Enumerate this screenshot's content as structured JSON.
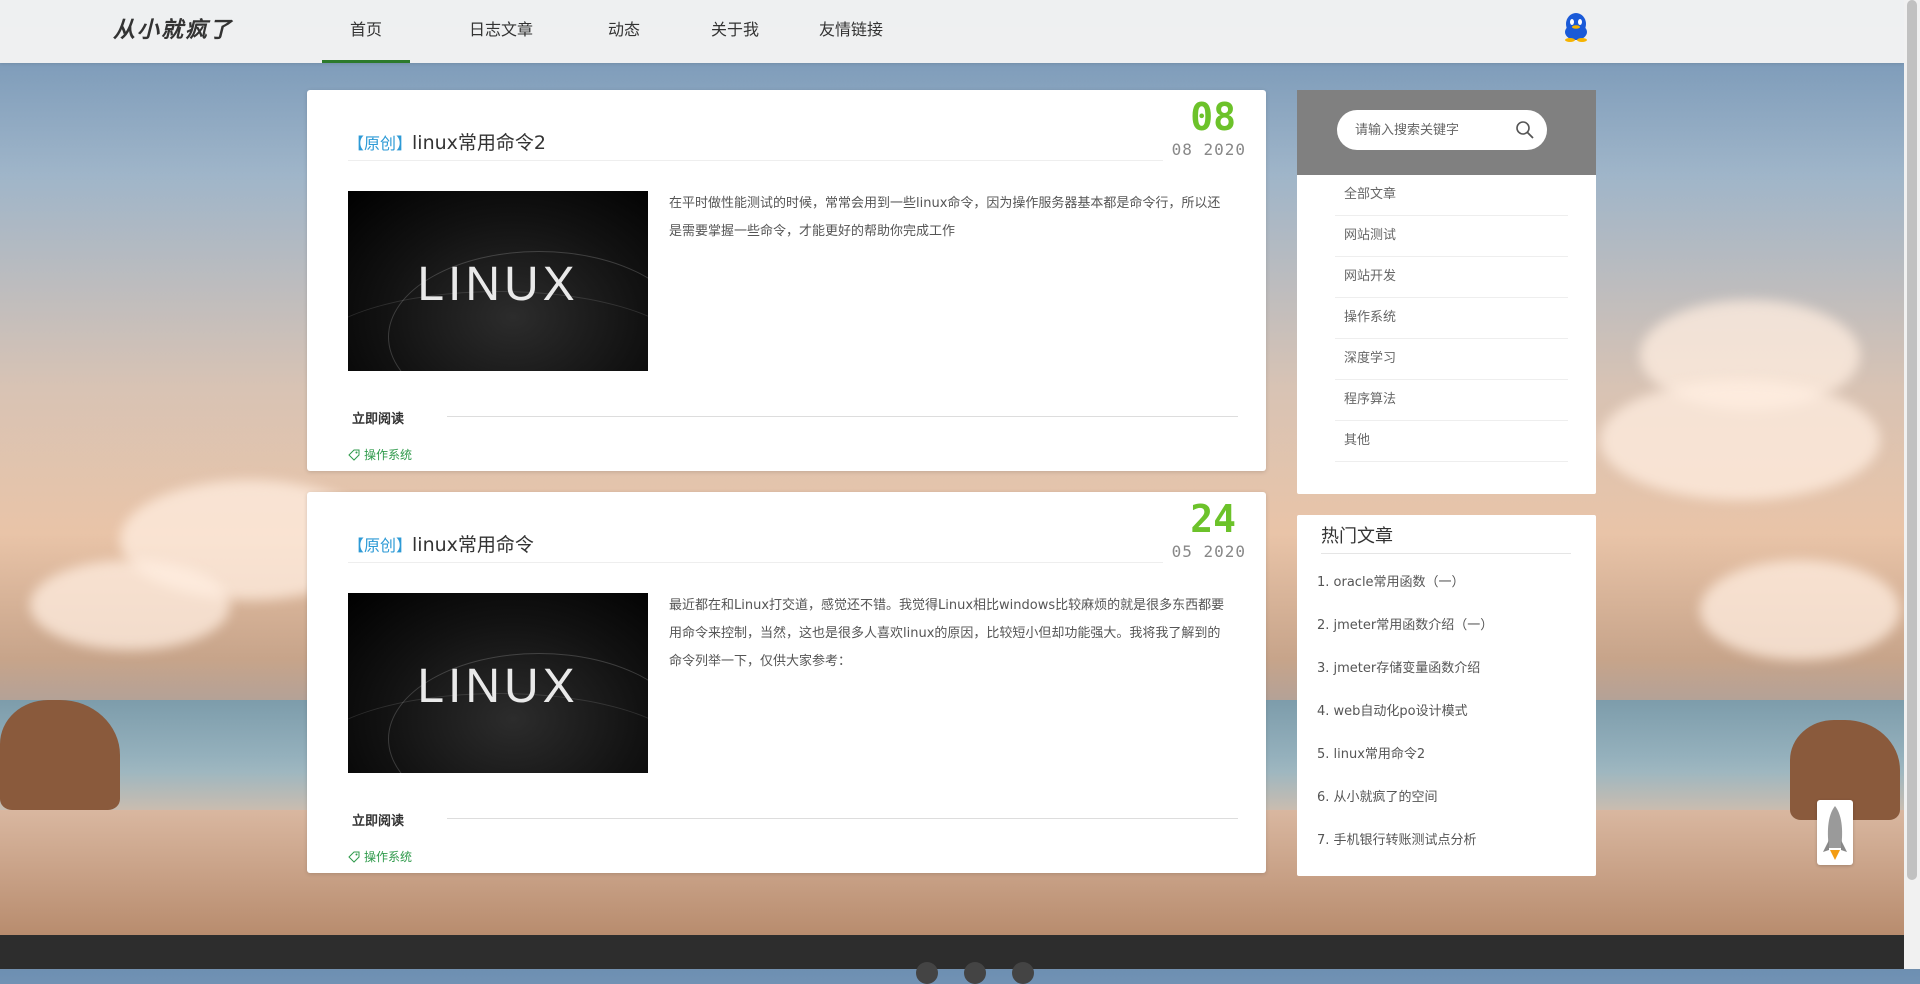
{
  "site": {
    "logo": "从小就疯了"
  },
  "nav": {
    "items": [
      {
        "label": "首页",
        "active": true
      },
      {
        "label": "日志文章",
        "active": false
      },
      {
        "label": "动态",
        "active": false
      },
      {
        "label": "关于我",
        "active": false
      },
      {
        "label": "友情链接",
        "active": false
      }
    ]
  },
  "posts": [
    {
      "badge": "【原创】",
      "title": "linux常用命令2",
      "day": "08",
      "month_year": "08 2020",
      "thumb_text": "LINUX",
      "excerpt": "在平时做性能测试的时候，常常会用到一些linux命令，因为操作服务器基本都是命令行，所以还是需要掌握一些命令，才能更好的帮助你完成工作",
      "read_more": "立即阅读",
      "tag": "操作系统"
    },
    {
      "badge": "【原创】",
      "title": "linux常用命令",
      "day": "24",
      "month_year": "05 2020",
      "thumb_text": "LINUX",
      "excerpt": "最近都在和Linux打交道，感觉还不错。我觉得Linux相比windows比较麻烦的就是很多东西都要用命令来控制，当然，这也是很多人喜欢linux的原因，比较短小但却功能强大。我将我了解到的命令列举一下，仅供大家参考：",
      "read_more": "立即阅读",
      "tag": "操作系统"
    }
  ],
  "sidebar": {
    "search": {
      "placeholder": "请输入搜索关键字"
    },
    "categories": [
      "全部文章",
      "网站测试",
      "网站开发",
      "操作系统",
      "深度学习",
      "程序算法",
      "其他"
    ],
    "hot": {
      "title": "热门文章",
      "items": [
        "1. oracle常用函数（一）",
        "2. jmeter常用函数介绍（一）",
        "3. jmeter存储变量函数介绍",
        "4. web自动化po设计模式",
        "5. linux常用命令2",
        "6. 从小就疯了的空间",
        "7. 手机银行转账测试点分析"
      ]
    }
  },
  "colors": {
    "accent_green": "#6cc22a",
    "badge_blue": "#2d9ad6",
    "tag_green": "#2f9a4b",
    "nav_active": "#2c7a2c"
  }
}
